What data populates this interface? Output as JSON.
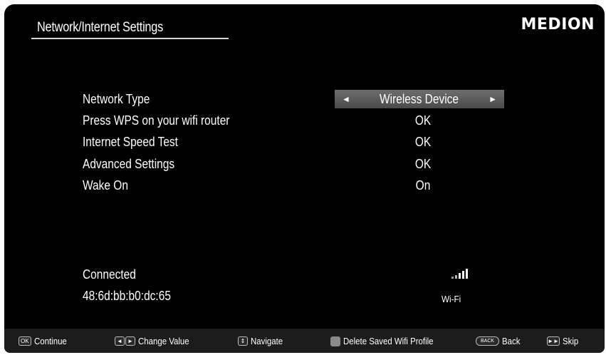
{
  "header": {
    "title": "Network/Internet Settings",
    "logo": "MEDION"
  },
  "settings": [
    {
      "label": "Network Type",
      "value": "Wireless Device",
      "type": "selector",
      "left_arrow": "◄",
      "right_arrow": "►"
    },
    {
      "label": "Press WPS on your wifi router",
      "value": "OK"
    },
    {
      "label": "Internet Speed Test",
      "value": "OK"
    },
    {
      "label": "Advanced Settings",
      "value": "OK"
    },
    {
      "label": "Wake On",
      "value": "On"
    }
  ],
  "status": {
    "connection": "Connected",
    "mac": "48:6d:bb:b0:dc:65",
    "signal_icon": "wifi-signal-icon",
    "network_label": "Wi-Fi"
  },
  "footer": {
    "continue": {
      "key": "OK",
      "label": "Continue"
    },
    "change_value": {
      "keys": [
        "◄",
        "►"
      ],
      "label": "Change Value"
    },
    "navigate": {
      "key": "⇕",
      "label": "Navigate"
    },
    "delete": {
      "label": "Delete Saved Wifi Profile"
    },
    "back": {
      "key": "BACK",
      "label": "Back"
    },
    "skip": {
      "key": "►►",
      "label": "Skip"
    }
  },
  "colors": {
    "background": "#000000",
    "selector": "#5c5c5c",
    "footer": "#1c1c1c",
    "text": "#ffffff"
  }
}
